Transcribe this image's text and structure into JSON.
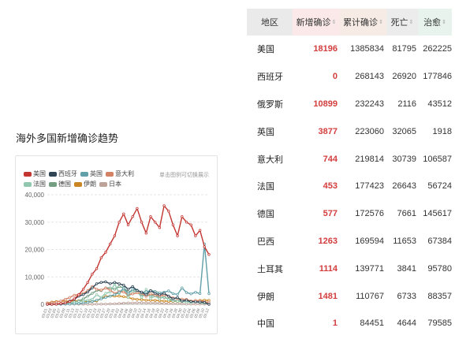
{
  "section": {
    "title": "海外多国新增确诊趋势"
  },
  "chart_hint": "单击图例可切换展示",
  "chart_data": {
    "type": "line",
    "ylim": [
      0,
      40000
    ],
    "yticks": [
      "40,000",
      "30,000",
      "20,000",
      "10,000",
      "0"
    ],
    "x": [
      "03.01",
      "03.03",
      "03.05",
      "03.07",
      "03.09",
      "03.11",
      "03.13",
      "03.15",
      "03.17",
      "03.19",
      "03.21",
      "03.23",
      "03.25",
      "03.27",
      "03.29",
      "03.31",
      "04.02",
      "04.04",
      "04.06",
      "04.08",
      "04.10",
      "04.12",
      "04.14",
      "04.16",
      "04.18",
      "04.20",
      "04.22",
      "04.24",
      "04.26",
      "04.28",
      "04.30",
      "05.02",
      "05.04",
      "05.06",
      "05.08",
      "05.10",
      "05.12"
    ],
    "series": [
      {
        "name": "美国",
        "color": "#c23531",
        "values": [
          20,
          40,
          100,
          300,
          500,
          1000,
          2000,
          3500,
          5500,
          8000,
          11000,
          13000,
          17000,
          19000,
          22000,
          25000,
          30000,
          33000,
          29000,
          32000,
          35000,
          30000,
          26000,
          32000,
          30000,
          28000,
          36000,
          34000,
          29000,
          25000,
          32000,
          30000,
          29000,
          25000,
          27000,
          21000,
          18196
        ]
      },
      {
        "name": "西班牙",
        "color": "#2f4554",
        "values": [
          10,
          20,
          50,
          200,
          500,
          1200,
          1800,
          3000,
          3500,
          4500,
          6000,
          7500,
          8000,
          8200,
          7500,
          8000,
          7500,
          7000,
          5500,
          6500,
          5000,
          4500,
          3500,
          5000,
          4000,
          3500,
          4000,
          3000,
          2000,
          2500,
          1200,
          1500,
          1000,
          900,
          800,
          700,
          0
        ]
      },
      {
        "name": "英国",
        "color": "#61a0a8",
        "values": [
          5,
          10,
          20,
          40,
          60,
          100,
          200,
          300,
          500,
          700,
          1000,
          1500,
          2000,
          2500,
          3000,
          3500,
          4300,
          5900,
          3800,
          5500,
          5200,
          4300,
          4600,
          5000,
          4700,
          4200,
          4400,
          4900,
          3900,
          3600,
          6000,
          4300,
          3800,
          4400,
          3900,
          22000,
          3877
        ]
      },
      {
        "name": "意大利",
        "color": "#d48265",
        "values": [
          500,
          600,
          800,
          1200,
          1800,
          2500,
          3300,
          3600,
          4000,
          5000,
          6500,
          5500,
          5200,
          5900,
          5200,
          4000,
          4600,
          4500,
          3600,
          3800,
          4200,
          4000,
          2900,
          3800,
          3400,
          3000,
          3400,
          3000,
          2300,
          2100,
          1900,
          1800,
          1200,
          1400,
          1300,
          900,
          744
        ]
      },
      {
        "name": "法国",
        "color": "#91c7ae",
        "values": [
          20,
          50,
          100,
          200,
          300,
          500,
          800,
          1000,
          1200,
          1500,
          1800,
          3500,
          2500,
          4000,
          4500,
          7500,
          4000,
          5500,
          2500,
          4500,
          4800,
          2500,
          5500,
          2200,
          3000,
          2000,
          3000,
          1700,
          1200,
          1100,
          1000,
          800,
          700,
          1000,
          600,
          400,
          453
        ]
      },
      {
        "name": "德国",
        "color": "#749f83",
        "values": [
          30,
          50,
          100,
          200,
          300,
          400,
          800,
          1200,
          2000,
          3000,
          4000,
          5000,
          5000,
          6000,
          6000,
          5500,
          6500,
          6000,
          4500,
          5000,
          4500,
          3000,
          3500,
          3000,
          3500,
          2500,
          2500,
          2000,
          1500,
          1300,
          1500,
          1000,
          900,
          1000,
          800,
          700,
          577
        ]
      },
      {
        "name": "伊朗",
        "color": "#ca8622",
        "values": [
          500,
          800,
          1000,
          1100,
          1200,
          1100,
          1200,
          1300,
          1200,
          1000,
          1000,
          1200,
          2200,
          2900,
          3000,
          3000,
          3000,
          2800,
          2500,
          2000,
          1800,
          1700,
          1500,
          1500,
          1400,
          1300,
          1200,
          1100,
          1100,
          1000,
          1000,
          1000,
          1100,
          1300,
          1400,
          1500,
          1481
        ]
      },
      {
        "name": "日本",
        "color": "#bda29a",
        "values": [
          5,
          10,
          20,
          30,
          40,
          50,
          60,
          50,
          40,
          30,
          40,
          60,
          80,
          100,
          150,
          200,
          300,
          400,
          500,
          500,
          600,
          600,
          500,
          500,
          500,
          400,
          300,
          300,
          200,
          200,
          150,
          100,
          100,
          80,
          60,
          50,
          40
        ]
      }
    ]
  },
  "table": {
    "headers": [
      "地区",
      "新增确诊",
      "累计确诊",
      "死亡",
      "治愈"
    ],
    "sort_glyph": "⇕",
    "rows": [
      [
        "美国",
        "18196",
        "1385834",
        "81795",
        "262225"
      ],
      [
        "西班牙",
        "0",
        "268143",
        "26920",
        "177846"
      ],
      [
        "俄罗斯",
        "10899",
        "232243",
        "2116",
        "43512"
      ],
      [
        "英国",
        "3877",
        "223060",
        "32065",
        "1918"
      ],
      [
        "意大利",
        "744",
        "219814",
        "30739",
        "106587"
      ],
      [
        "法国",
        "453",
        "177423",
        "26643",
        "56724"
      ],
      [
        "德国",
        "577",
        "172576",
        "7661",
        "145617"
      ],
      [
        "巴西",
        "1263",
        "169594",
        "11653",
        "67384"
      ],
      [
        "土耳其",
        "1114",
        "139771",
        "3841",
        "95780"
      ],
      [
        "伊朗",
        "1481",
        "110767",
        "6733",
        "88357"
      ],
      [
        "中国",
        "1",
        "84451",
        "4644",
        "79585"
      ]
    ]
  }
}
